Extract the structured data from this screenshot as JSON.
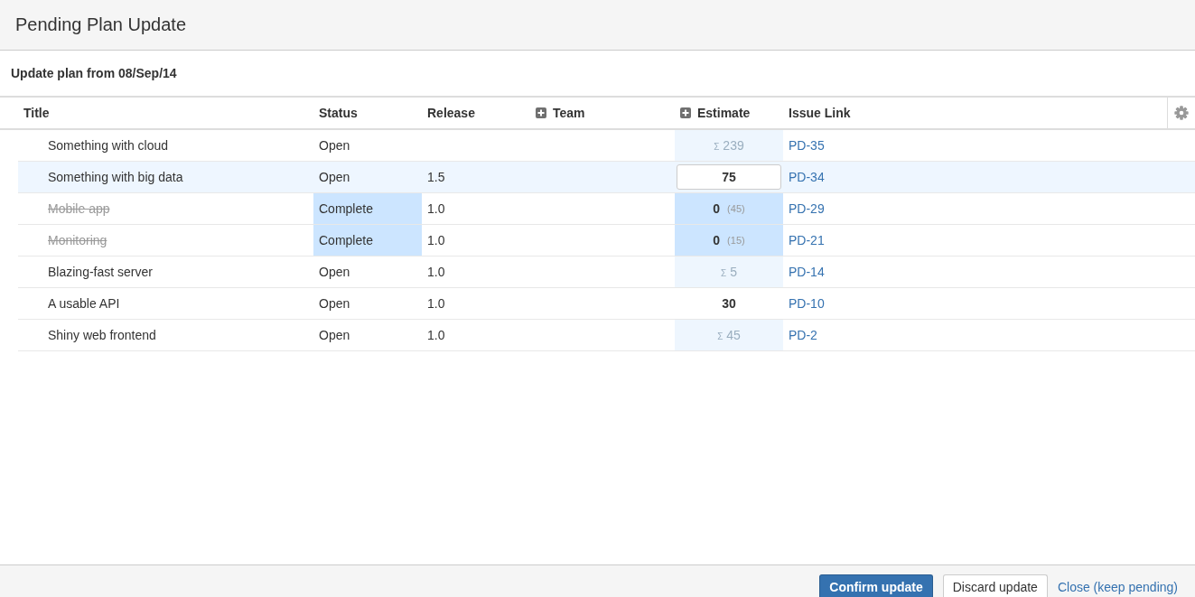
{
  "dialog": {
    "title": "Pending Plan Update"
  },
  "subtitle": "Update plan from 08/Sep/14",
  "table": {
    "columns": [
      {
        "label": "Title",
        "expandable": false
      },
      {
        "label": "Status",
        "expandable": false
      },
      {
        "label": "Release",
        "expandable": false
      },
      {
        "label": "Team",
        "expandable": true
      },
      {
        "label": "Estimate",
        "expandable": true
      },
      {
        "label": "Issue Link",
        "expandable": false
      }
    ],
    "rows": [
      {
        "title": "Something with cloud",
        "status": "Open",
        "release": "",
        "estimate": {
          "kind": "sum",
          "symbol": "Σ",
          "value": "239"
        },
        "link": "PD-35",
        "selected": false,
        "complete": false
      },
      {
        "title": "Something with big data",
        "status": "Open",
        "release": "1.5",
        "estimate": {
          "kind": "edit",
          "value": "75"
        },
        "link": "PD-34",
        "selected": true,
        "complete": false
      },
      {
        "title": "Mobile app",
        "status": "Complete",
        "release": "1.0",
        "estimate": {
          "kind": "changed",
          "value": "0",
          "previous": "(45)"
        },
        "link": "PD-29",
        "selected": false,
        "complete": true
      },
      {
        "title": "Monitoring",
        "status": "Complete",
        "release": "1.0",
        "estimate": {
          "kind": "changed",
          "value": "0",
          "previous": "(15)"
        },
        "link": "PD-21",
        "selected": false,
        "complete": true
      },
      {
        "title": "Blazing-fast server",
        "status": "Open",
        "release": "1.0",
        "estimate": {
          "kind": "sum",
          "symbol": "Σ",
          "value": "5"
        },
        "link": "PD-14",
        "selected": false,
        "complete": false
      },
      {
        "title": "A usable API",
        "status": "Open",
        "release": "1.0",
        "estimate": {
          "kind": "plain",
          "value": "30"
        },
        "link": "PD-10",
        "selected": false,
        "complete": false
      },
      {
        "title": "Shiny web frontend",
        "status": "Open",
        "release": "1.0",
        "estimate": {
          "kind": "sum",
          "symbol": "Σ",
          "value": "45"
        },
        "link": "PD-2",
        "selected": false,
        "complete": false
      }
    ]
  },
  "buttons": [
    {
      "label": "Confirm update",
      "kind": "primary"
    },
    {
      "label": "Discard update",
      "kind": "default"
    },
    {
      "label": "Close (keep pending)",
      "kind": "link"
    }
  ]
}
